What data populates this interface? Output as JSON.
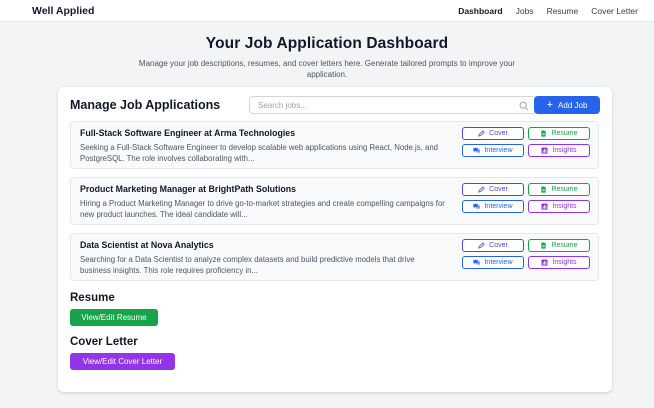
{
  "nav": {
    "brand": "Well Applied",
    "links": [
      "Dashboard",
      "Jobs",
      "Resume",
      "Cover Letter"
    ]
  },
  "header": {
    "title": "Your Job Application Dashboard",
    "subtitle": "Manage your job descriptions, resumes, and cover letters here. Generate tailored prompts to improve your application."
  },
  "jobs_section": {
    "title": "Manage Job Applications",
    "search_placeholder": "Search jobs...",
    "add_label": "Add Job",
    "button_labels": {
      "cover": "Cover",
      "resume": "Resume",
      "interview": "Interview",
      "insights": "Insights"
    },
    "items": [
      {
        "title": "Full-Stack Software Engineer at Arma Technologies",
        "description": "Seeking a Full-Stack Software Engineer to develop scalable web applications using React, Node.js, and PostgreSQL. The role involves collaborating with..."
      },
      {
        "title": "Product Marketing Manager at BrightPath Solutions",
        "description": "Hiring a Product Marketing Manager to drive go-to-market strategies and create compelling campaigns for new product launches. The ideal candidate will..."
      },
      {
        "title": "Data Scientist at Nova Analytics",
        "description": "Searching for a Data Scientist to analyze complex datasets and build predictive models that drive business insights. This role requires proficiency in..."
      }
    ]
  },
  "resume_section": {
    "title": "Resume",
    "button": "View/Edit Resume"
  },
  "cover_section": {
    "title": "Cover Letter",
    "button": "View/Edit Cover Letter"
  },
  "colors": {
    "primary": "#2563eb",
    "green": "#16a34a",
    "purple": "#9333ea",
    "indigo": "#4f46e5"
  },
  "icons": {
    "search": "search-icon",
    "add": "plus-icon",
    "cover": "pencil-icon",
    "resume": "document-icon",
    "interview": "chat-icon",
    "insights": "chart-icon"
  }
}
